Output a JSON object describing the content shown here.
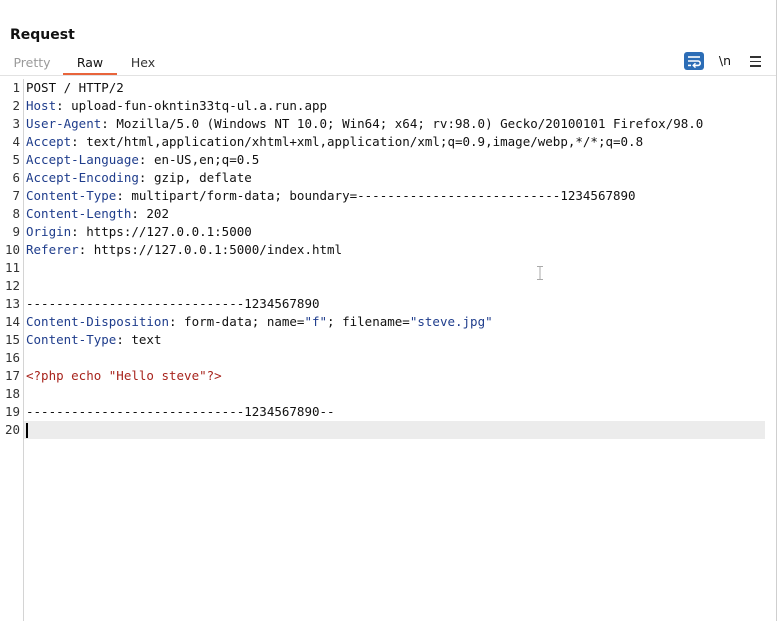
{
  "panel": {
    "title": "Request"
  },
  "tabs": [
    {
      "label": "Pretty"
    },
    {
      "label": "Raw"
    },
    {
      "label": "Hex"
    }
  ],
  "tools": {
    "newline_label": "\\n"
  },
  "colors": {
    "tab_active_underline": "#e8643b",
    "wrap_button": "#2c6db6",
    "header_key": "#1f3d8c",
    "php_code": "#a8241d"
  },
  "lines": [
    {
      "num": "1",
      "parts": [
        {
          "t": "POST / HTTP/2",
          "c": "v"
        }
      ]
    },
    {
      "num": "2",
      "parts": [
        {
          "t": "Host",
          "c": "k"
        },
        {
          "t": ": upload-fun-okntin33tq-ul.a.run.app",
          "c": "v"
        }
      ]
    },
    {
      "num": "3",
      "parts": [
        {
          "t": "User-Agent",
          "c": "k"
        },
        {
          "t": ": Mozilla/5.0 (Windows NT 10.0; Win64; x64; rv:98.0) Gecko/20100101 Firefox/98.0",
          "c": "v"
        }
      ]
    },
    {
      "num": "4",
      "parts": [
        {
          "t": "Accept",
          "c": "k"
        },
        {
          "t": ": text/html,application/xhtml+xml,application/xml;q=0.9,image/webp,*/*;q=0.8",
          "c": "v"
        }
      ]
    },
    {
      "num": "5",
      "parts": [
        {
          "t": "Accept-Language",
          "c": "k"
        },
        {
          "t": ": en-US,en;q=0.5",
          "c": "v"
        }
      ]
    },
    {
      "num": "6",
      "parts": [
        {
          "t": "Accept-Encoding",
          "c": "k"
        },
        {
          "t": ": gzip, deflate",
          "c": "v"
        }
      ]
    },
    {
      "num": "7",
      "parts": [
        {
          "t": "Content-Type",
          "c": "k"
        },
        {
          "t": ": multipart/form-data; boundary=---------------------------1234567890",
          "c": "v"
        }
      ]
    },
    {
      "num": "8",
      "parts": [
        {
          "t": "Content-Length",
          "c": "k"
        },
        {
          "t": ": 202",
          "c": "v"
        }
      ]
    },
    {
      "num": "9",
      "parts": [
        {
          "t": "Origin",
          "c": "k"
        },
        {
          "t": ": https://127.0.0.1:5000",
          "c": "v"
        }
      ]
    },
    {
      "num": "10",
      "parts": [
        {
          "t": "Referer",
          "c": "k"
        },
        {
          "t": ": https://127.0.0.1:5000/index.html",
          "c": "v"
        }
      ]
    },
    {
      "num": "11",
      "parts": []
    },
    {
      "num": "12",
      "parts": []
    },
    {
      "num": "13",
      "parts": [
        {
          "t": "-----------------------------1234567890",
          "c": "v"
        }
      ]
    },
    {
      "num": "14",
      "parts": [
        {
          "t": "Content-Disposition",
          "c": "k"
        },
        {
          "t": ": form-data; name=",
          "c": "v"
        },
        {
          "t": "\"f\"",
          "c": "str"
        },
        {
          "t": "; filename=",
          "c": "v"
        },
        {
          "t": "\"steve.jpg\"",
          "c": "str"
        }
      ]
    },
    {
      "num": "15",
      "parts": [
        {
          "t": "Content-Type",
          "c": "k"
        },
        {
          "t": ": text",
          "c": "v"
        }
      ]
    },
    {
      "num": "16",
      "parts": []
    },
    {
      "num": "17",
      "parts": [
        {
          "t": "<?php echo \"Hello steve\"?>",
          "c": "php"
        }
      ]
    },
    {
      "num": "18",
      "parts": []
    },
    {
      "num": "19",
      "parts": [
        {
          "t": "-----------------------------1234567890--",
          "c": "v"
        }
      ]
    },
    {
      "num": "20",
      "parts": [],
      "current": true
    }
  ]
}
